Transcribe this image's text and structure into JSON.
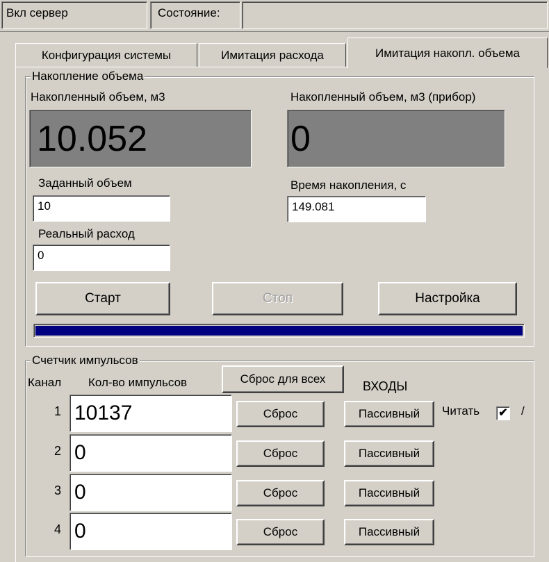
{
  "statusbar": {
    "server_label": "Вкл сервер",
    "state_label": "Состояние:",
    "state_value": ""
  },
  "tabs": [
    {
      "label": "Конфигурация системы",
      "active": false
    },
    {
      "label": "Имитация расхода",
      "active": false
    },
    {
      "label": "Имитация накопл. объема",
      "active": true
    }
  ],
  "volume": {
    "group_title": "Накопление объема",
    "accumulated_label": "Накопленный объем, м3",
    "accumulated_value": "10.052",
    "device_label": "Накопленный объем, м3 (прибор)",
    "device_value": "0",
    "target_label": "Заданный объем",
    "target_value": "10",
    "time_label": "Время накопления, с",
    "time_value": "149.081",
    "real_flow_label": "Реальный расход",
    "real_flow_value": "0",
    "start_label": "Старт",
    "stop_label": "Стоп",
    "settings_label": "Настройка",
    "progress_fraction": 1.0
  },
  "pulses": {
    "group_title": "Счетчик импульсов",
    "channel_header": "Канал",
    "count_header": "Кол-во импульсов",
    "reset_all_label": "Сброс для всех",
    "inputs_header": "ВХОДЫ",
    "read_label": "Читать",
    "read_checked": true,
    "read_suffix": "/",
    "rows": [
      {
        "channel": "1",
        "count": "10137",
        "reset": "Сброс",
        "mode": "Пассивный"
      },
      {
        "channel": "2",
        "count": "0",
        "reset": "Сброс",
        "mode": "Пассивный"
      },
      {
        "channel": "3",
        "count": "0",
        "reset": "Сброс",
        "mode": "Пассивный"
      },
      {
        "channel": "4",
        "count": "0",
        "reset": "Сброс",
        "mode": "Пассивный"
      }
    ]
  },
  "colors": {
    "face": "#d4d0c8",
    "display_bg": "#808080",
    "progress": "#000080"
  }
}
